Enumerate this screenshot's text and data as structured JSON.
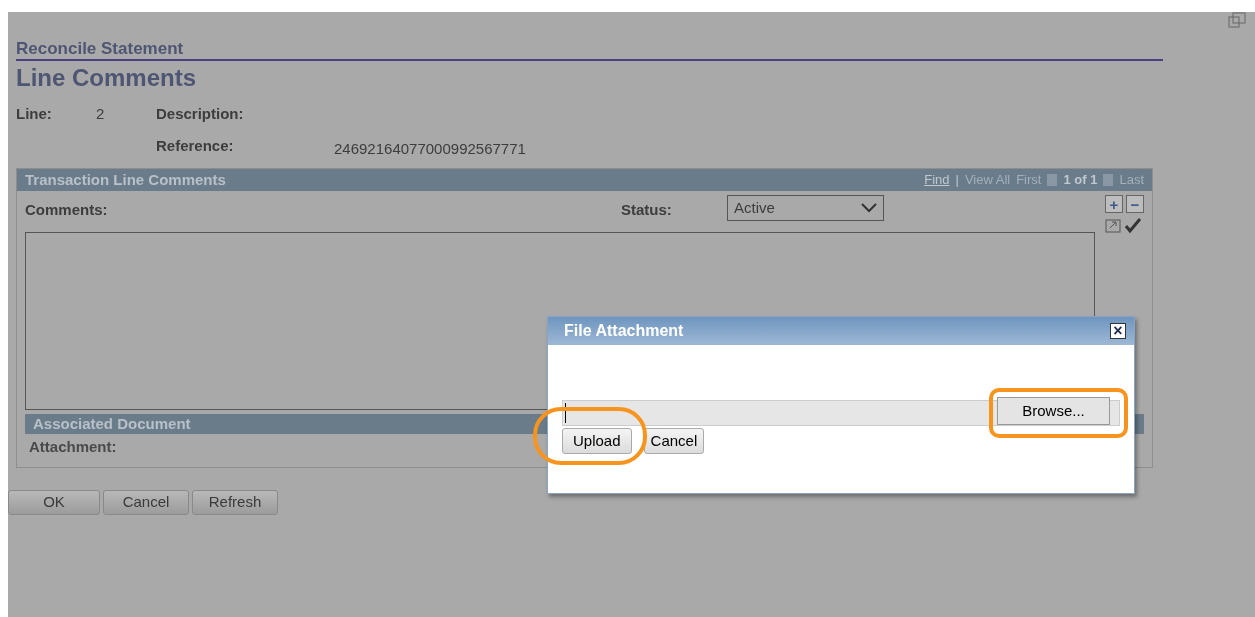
{
  "page": {
    "breadcrumb": "Reconcile Statement",
    "title": "Line Comments"
  },
  "fields": [
    {
      "label": "Line:",
      "value": "2"
    },
    {
      "label": "Description:"
    },
    {
      "label": "Reference:",
      "value": "24692164077000992567771"
    }
  ],
  "grid": {
    "title": "Transaction Line Comments",
    "nav": {
      "find": "Find",
      "separator": "|",
      "view_all": "View All",
      "first": "First",
      "count": "1 of 1",
      "last": "Last"
    },
    "comments_label": "Comments:",
    "status_label": "Status:",
    "status_value": "Active",
    "add": "+",
    "remove": "−"
  },
  "associated": {
    "title": "Associated Document",
    "attachment_label": "Attachment:"
  },
  "buttons": [
    "OK",
    "Cancel",
    "Refresh"
  ],
  "dialog": {
    "title": "File Attachment",
    "close": "×",
    "browse": "Browse...",
    "upload": "Upload",
    "cancel": "Cancel"
  }
}
